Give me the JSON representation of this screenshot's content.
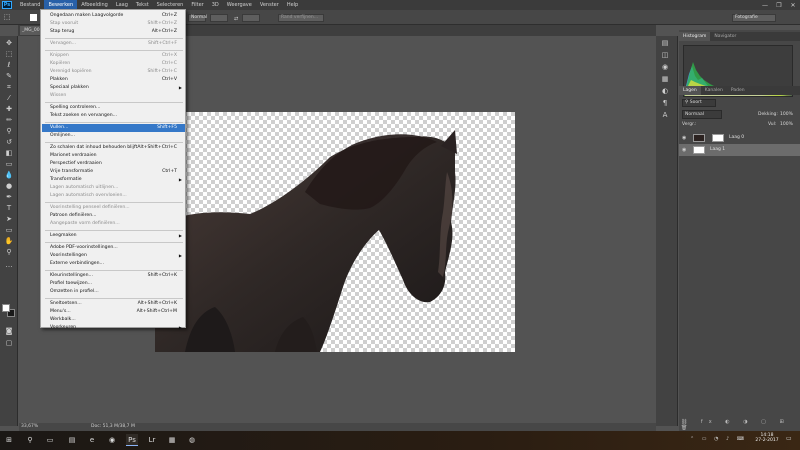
{
  "app": {
    "logo": "Ps"
  },
  "menubar": {
    "items": [
      "Bestand",
      "Bewerken",
      "Afbeelding",
      "Laag",
      "Tekst",
      "Selecteren",
      "Filter",
      "3D",
      "Weergave",
      "Venster",
      "Help"
    ],
    "active_index": 1,
    "window_controls": [
      "—",
      "❐",
      "✕"
    ]
  },
  "options": {
    "mode": "Normal",
    "refine_button": "Rand verfijnen...",
    "workspace": "Fotografie"
  },
  "document": {
    "tab_label": "_MG_000",
    "zoom": "33,67%",
    "doc_info": "Doc: 51,3 M/38,7 M"
  },
  "edit_menu": {
    "items": [
      {
        "label": "Ongedaan maken Laagvolgorde",
        "shortcut": "Ctrl+Z",
        "disabled": false
      },
      {
        "label": "Stap vooruit",
        "shortcut": "Shift+Ctrl+Z",
        "disabled": true
      },
      {
        "label": "Stap terug",
        "shortcut": "Alt+Ctrl+Z",
        "disabled": false
      },
      {
        "sep": true
      },
      {
        "label": "Vervagen...",
        "shortcut": "Shift+Ctrl+F",
        "disabled": true
      },
      {
        "sep": true
      },
      {
        "label": "Knippen",
        "shortcut": "Ctrl+X",
        "disabled": true
      },
      {
        "label": "Kopiëren",
        "shortcut": "Ctrl+C",
        "disabled": true
      },
      {
        "label": "Verenigd kopiëren",
        "shortcut": "Shift+Ctrl+C",
        "disabled": true
      },
      {
        "label": "Plakken",
        "shortcut": "Ctrl+V",
        "disabled": false
      },
      {
        "label": "Speciaal plakken",
        "shortcut": "",
        "disabled": false,
        "submenu": true
      },
      {
        "label": "Wissen",
        "shortcut": "",
        "disabled": true
      },
      {
        "sep": true
      },
      {
        "label": "Spelling controleren...",
        "shortcut": "",
        "disabled": false
      },
      {
        "label": "Tekst zoeken en vervangen...",
        "shortcut": "",
        "disabled": false
      },
      {
        "sep": true
      },
      {
        "label": "Vullen...",
        "shortcut": "Shift+F5",
        "disabled": false,
        "highlight": true
      },
      {
        "label": "Omlijnen...",
        "shortcut": "",
        "disabled": false
      },
      {
        "sep": true
      },
      {
        "label": "Zo schalen dat inhoud behouden blijft",
        "shortcut": "Alt+Shift+Ctrl+C",
        "disabled": false
      },
      {
        "label": "Marionet verdraaien",
        "shortcut": "",
        "disabled": false
      },
      {
        "label": "Perspectief verdraaien",
        "shortcut": "",
        "disabled": false
      },
      {
        "label": "Vrije transformatie",
        "shortcut": "Ctrl+T",
        "disabled": false
      },
      {
        "label": "Transformatie",
        "shortcut": "",
        "disabled": false,
        "submenu": true
      },
      {
        "label": "Lagen automatisch uitlijnen...",
        "shortcut": "",
        "disabled": true
      },
      {
        "label": "Lagen automatisch overvloeien...",
        "shortcut": "",
        "disabled": true
      },
      {
        "sep": true
      },
      {
        "label": "Voorinstelling penseel definiëren...",
        "shortcut": "",
        "disabled": true
      },
      {
        "label": "Patroon definiëren...",
        "shortcut": "",
        "disabled": false
      },
      {
        "label": "Aangepaste vorm definiëren...",
        "shortcut": "",
        "disabled": true
      },
      {
        "sep": true
      },
      {
        "label": "Leegmaken",
        "shortcut": "",
        "disabled": false,
        "submenu": true
      },
      {
        "sep": true
      },
      {
        "label": "Adobe PDF-voorinstellingen...",
        "shortcut": "",
        "disabled": false
      },
      {
        "label": "Voorinstellingen",
        "shortcut": "",
        "disabled": false,
        "submenu": true
      },
      {
        "label": "Externe verbindingen...",
        "shortcut": "",
        "disabled": false
      },
      {
        "sep": true
      },
      {
        "label": "Kleurinstellingen...",
        "shortcut": "Shift+Ctrl+K",
        "disabled": false
      },
      {
        "label": "Profiel toewijzen...",
        "shortcut": "",
        "disabled": false
      },
      {
        "label": "Omzetten in profiel...",
        "shortcut": "",
        "disabled": false
      },
      {
        "sep": true
      },
      {
        "label": "Sneltoetsen...",
        "shortcut": "Alt+Shift+Ctrl+K",
        "disabled": false
      },
      {
        "label": "Menu's...",
        "shortcut": "Alt+Shift+Ctrl+M",
        "disabled": false
      },
      {
        "label": "Werkbalk...",
        "shortcut": "",
        "disabled": false
      },
      {
        "label": "Voorkeuren",
        "shortcut": "",
        "disabled": false,
        "submenu": true
      }
    ]
  },
  "panels": {
    "top_tabs": [
      "Histogram",
      "Navigator"
    ],
    "layer_tabs": [
      "Lagen",
      "Kanalen",
      "Paden"
    ],
    "filter_label": "Soort",
    "blend_mode": "Normaal",
    "opacity_label": "Dekking:",
    "opacity_value": "100%",
    "lock_label": "Vergr.:",
    "fill_label": "Vul:",
    "fill_value": "100%",
    "layers": [
      {
        "name": "Laag 0",
        "selected": false
      },
      {
        "name": "Laag 1",
        "selected": true
      }
    ]
  },
  "taskbar": {
    "time": "14:18",
    "date": "27-2-2017"
  }
}
